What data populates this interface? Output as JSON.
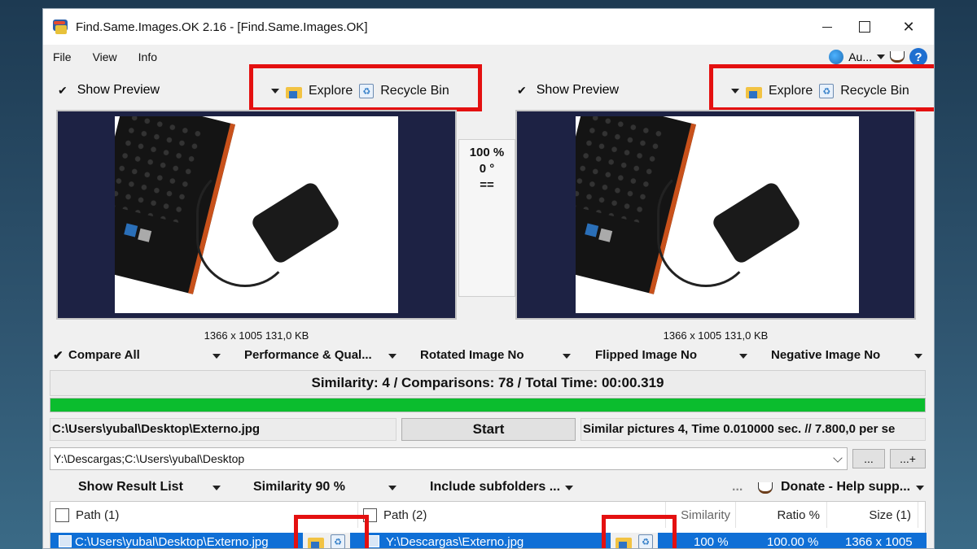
{
  "window": {
    "title": "Find.Same.Images.OK 2.16 - [Find.Same.Images.OK]",
    "close_glyph": "✕"
  },
  "menu": {
    "file": "File",
    "view": "View",
    "info": "Info",
    "language": "Au...",
    "help": "?"
  },
  "left_pane": {
    "show_preview": "Show Preview",
    "explore": "Explore",
    "recycle_bin": "Recycle Bin",
    "image_info": "1366 x 1005 131,0 KB"
  },
  "right_pane": {
    "show_preview": "Show Preview",
    "explore": "Explore",
    "recycle_bin": "Recycle Bin",
    "image_info": "1366 x 1005 131,0 KB"
  },
  "compare_stats": {
    "similarity_pct": "100 %",
    "rotation": "0 °",
    "equal": "=="
  },
  "options": {
    "compare_all": "Compare All",
    "performance": "Performance & Qual...",
    "rotated": "Rotated Image No",
    "flipped": "Flipped Image No",
    "negative": "Negative Image No"
  },
  "summary": "Similarity: 4 / Comparisons: 78 / Total Time: 00:00.319",
  "progress_fraction": 1.0,
  "current_path": "C:\\Users\\yubal\\Desktop\\Externo.jpg",
  "start_label": "Start",
  "status": "Similar pictures 4, Time 0.010000 sec. // 7.800,0 per se",
  "folders": "Y:\\Descargas;C:\\Users\\yubal\\Desktop",
  "browse_button": "...",
  "add_button": "...+",
  "options2": {
    "show_result_list": "Show Result List",
    "similarity": "Similarity 90 %",
    "include_subfolders": "Include subfolders ...",
    "more": "...",
    "donate": "Donate - Help supp..."
  },
  "table": {
    "headers": [
      "Path (1)",
      "Path (2)",
      "Similarity",
      "Ratio %",
      "Size (1)"
    ],
    "rows": [
      {
        "path1": "C:\\Users\\yubal\\Desktop\\Externo.jpg",
        "path2": "Y:\\Descargas\\Externo.jpg",
        "similarity": "100 %",
        "ratio": "100.00 %",
        "size1": "1366 x 1005"
      }
    ]
  },
  "colors": {
    "highlight_red": "#e41010",
    "progress_green": "#0bbd2e",
    "selection_blue": "#0f6fd6",
    "preview_bg": "#1d2244"
  }
}
